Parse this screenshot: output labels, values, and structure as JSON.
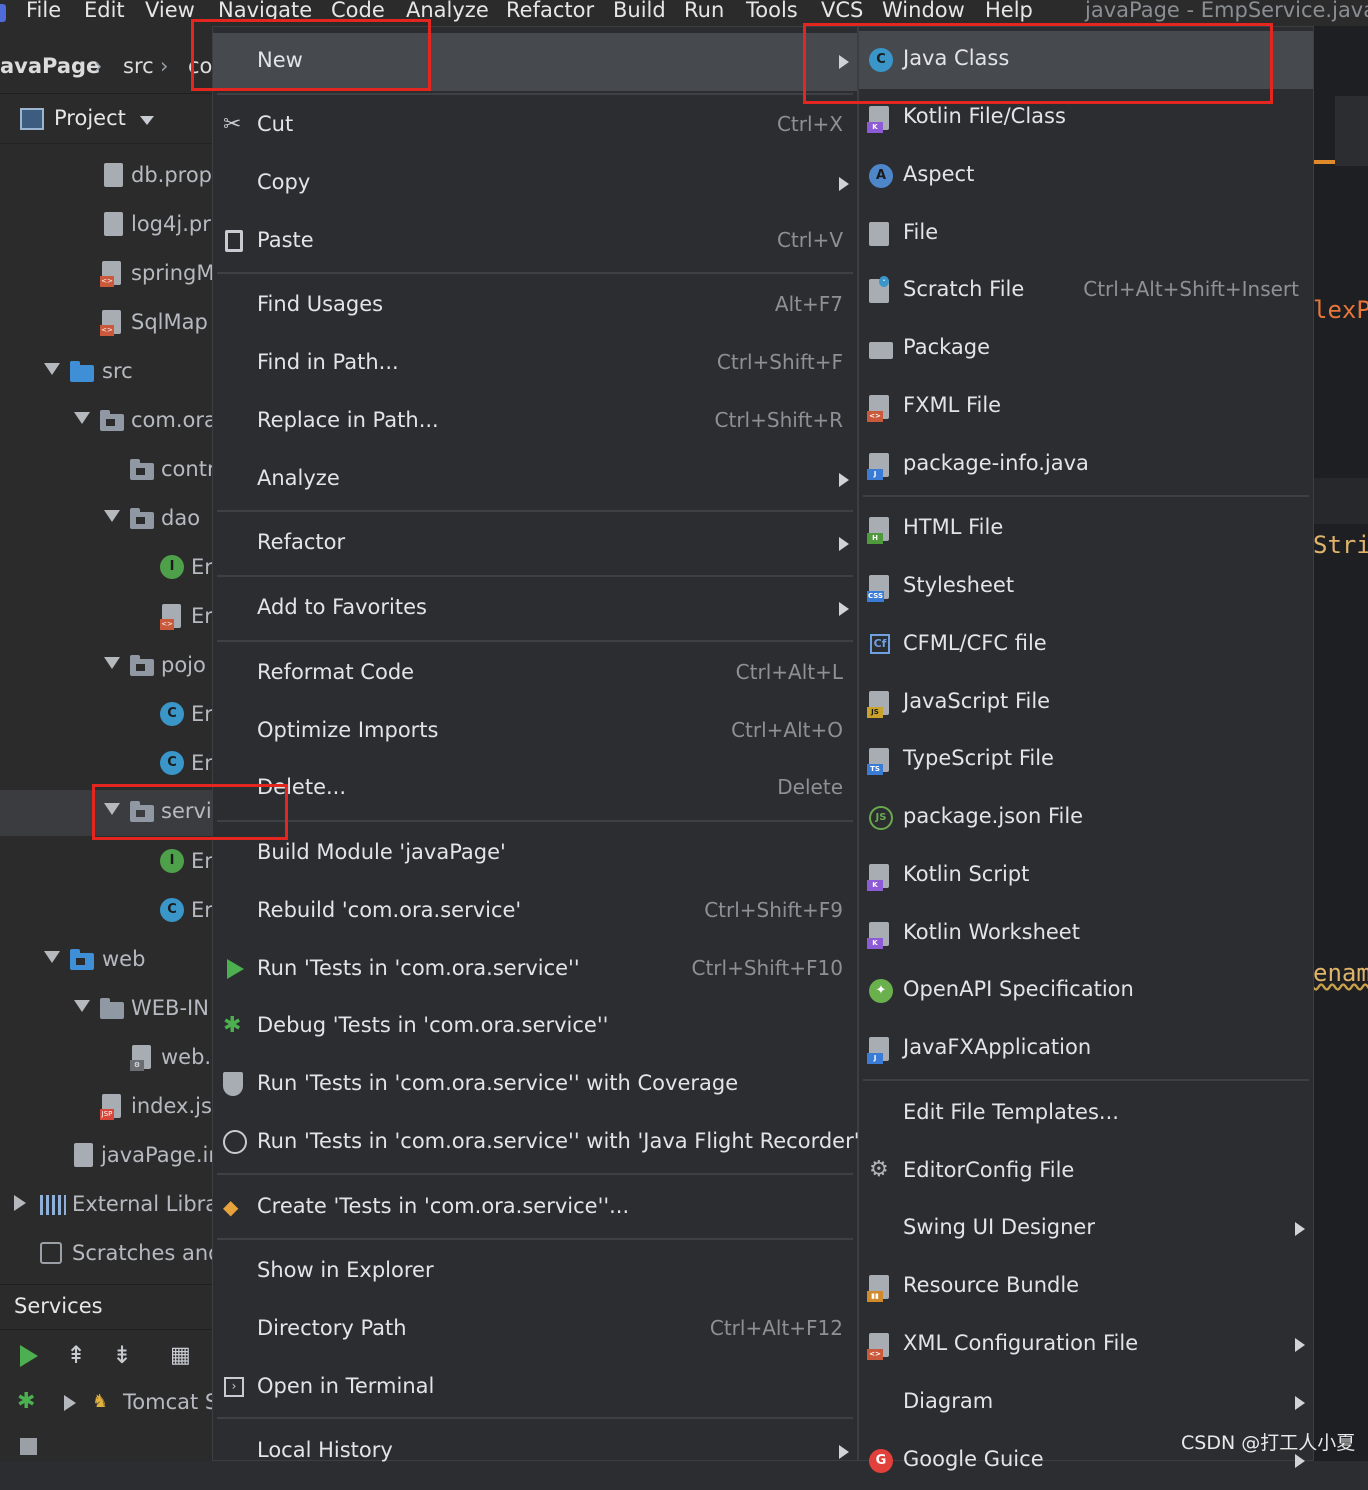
{
  "menubar": {
    "items": [
      "File",
      "Edit",
      "View",
      "Navigate",
      "Code",
      "Analyze",
      "Refactor",
      "Build",
      "Run",
      "Tools",
      "VCS",
      "Window",
      "Help"
    ],
    "window_title": "javaPage - EmpService.java"
  },
  "breadcrumb": [
    "avaPage",
    "src",
    "co"
  ],
  "project": {
    "header": "Project",
    "tree": [
      "db.prop",
      "log4j.pr",
      "springM",
      "SqlMap",
      "src",
      "com.ora",
      "contr",
      "dao",
      "Er",
      "Er",
      "pojo",
      "Er",
      "Er",
      "servi",
      "Er",
      "Er",
      "web",
      "WEB-IN",
      "web.",
      "index.jsp",
      "javaPage.ir",
      "External Libra",
      "Scratches and"
    ]
  },
  "services": {
    "title": "Services",
    "tomcat": "Tomcat S"
  },
  "editor_fragments": [
    "lexP",
    "Stri",
    "enam"
  ],
  "main_menu": {
    "new": "New",
    "cut": "Cut",
    "cut_sc": "Ctrl+X",
    "copy": "Copy",
    "paste": "Paste",
    "paste_sc": "Ctrl+V",
    "find_usages": "Find Usages",
    "find_usages_sc": "Alt+F7",
    "find_in_path": "Find in Path...",
    "find_in_path_sc": "Ctrl+Shift+F",
    "replace_in_path": "Replace in Path...",
    "replace_in_path_sc": "Ctrl+Shift+R",
    "analyze": "Analyze",
    "refactor": "Refactor",
    "add_favorites": "Add to Favorites",
    "reformat": "Reformat Code",
    "reformat_sc": "Ctrl+Alt+L",
    "optimize": "Optimize Imports",
    "optimize_sc": "Ctrl+Alt+O",
    "delete": "Delete...",
    "delete_sc": "Delete",
    "build_module": "Build Module 'javaPage'",
    "rebuild": "Rebuild 'com.ora.service'",
    "rebuild_sc": "Ctrl+Shift+F9",
    "run_tests": "Run 'Tests in 'com.ora.service''",
    "run_tests_sc": "Ctrl+Shift+F10",
    "debug_tests": "Debug 'Tests in 'com.ora.service''",
    "run_coverage": "Run 'Tests in 'com.ora.service'' with Coverage",
    "run_jfr": "Run 'Tests in 'com.ora.service'' with 'Java Flight Recorder'",
    "create_tests": "Create 'Tests in 'com.ora.service''...",
    "show_explorer": "Show in Explorer",
    "directory_path": "Directory Path",
    "directory_path_sc": "Ctrl+Alt+F12",
    "open_terminal": "Open in Terminal",
    "local_history": "Local History"
  },
  "new_menu": {
    "java_class": "Java Class",
    "kotlin_file": "Kotlin File/Class",
    "aspect": "Aspect",
    "file": "File",
    "scratch_file": "Scratch File",
    "scratch_file_sc": "Ctrl+Alt+Shift+Insert",
    "package": "Package",
    "fxml_file": "FXML File",
    "package_info": "package-info.java",
    "html_file": "HTML File",
    "stylesheet": "Stylesheet",
    "cfml": "CFML/CFC file",
    "javascript": "JavaScript File",
    "typescript": "TypeScript File",
    "package_json": "package.json File",
    "kotlin_script": "Kotlin Script",
    "kotlin_worksheet": "Kotlin Worksheet",
    "openapi": "OpenAPI Specification",
    "javafx_app": "JavaFXApplication",
    "edit_templates": "Edit File Templates...",
    "editorconfig": "EditorConfig File",
    "swing_designer": "Swing UI Designer",
    "resource_bundle": "Resource Bundle",
    "xml_config": "XML Configuration File",
    "diagram": "Diagram",
    "google_guice": "Google Guice"
  },
  "watermark": "CSDN @打工人小夏",
  "colors": {
    "highlight_box": "#e3261f",
    "menu_bg": "#2b2d30",
    "selection": "#46494e"
  }
}
